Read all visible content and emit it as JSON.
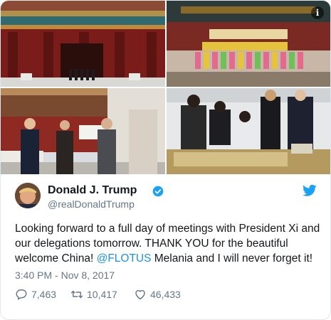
{
  "media": {
    "photos": [
      {
        "name": "photo-forbidden-city"
      },
      {
        "name": "photo-children-performance"
      },
      {
        "name": "photo-leaders-walking"
      },
      {
        "name": "photo-calligraphy-viewing"
      }
    ]
  },
  "author": {
    "display_name": "Donald J. Trump",
    "handle": "@realDonaldTrump",
    "verified": true
  },
  "tweet": {
    "text_before": "Looking forward to a full day of meetings with President Xi and our delegations tomorrow. THANK YOU for the beautiful welcome China! ",
    "mention": "@FLOTUS",
    "text_after": " Melania and I will never forget it!",
    "timestamp": "3:40 PM - Nov 8, 2017"
  },
  "stats": {
    "replies": "7,463",
    "retweets": "10,417",
    "likes": "46,433"
  },
  "colors": {
    "link": "#1b95e0",
    "muted": "#657786",
    "border": "#e1e8ed",
    "twitter_blue": "#1da1f2"
  },
  "icons": [
    "info-icon",
    "verified-badge-icon",
    "twitter-bird-icon",
    "reply-icon",
    "retweet-icon",
    "like-icon"
  ]
}
